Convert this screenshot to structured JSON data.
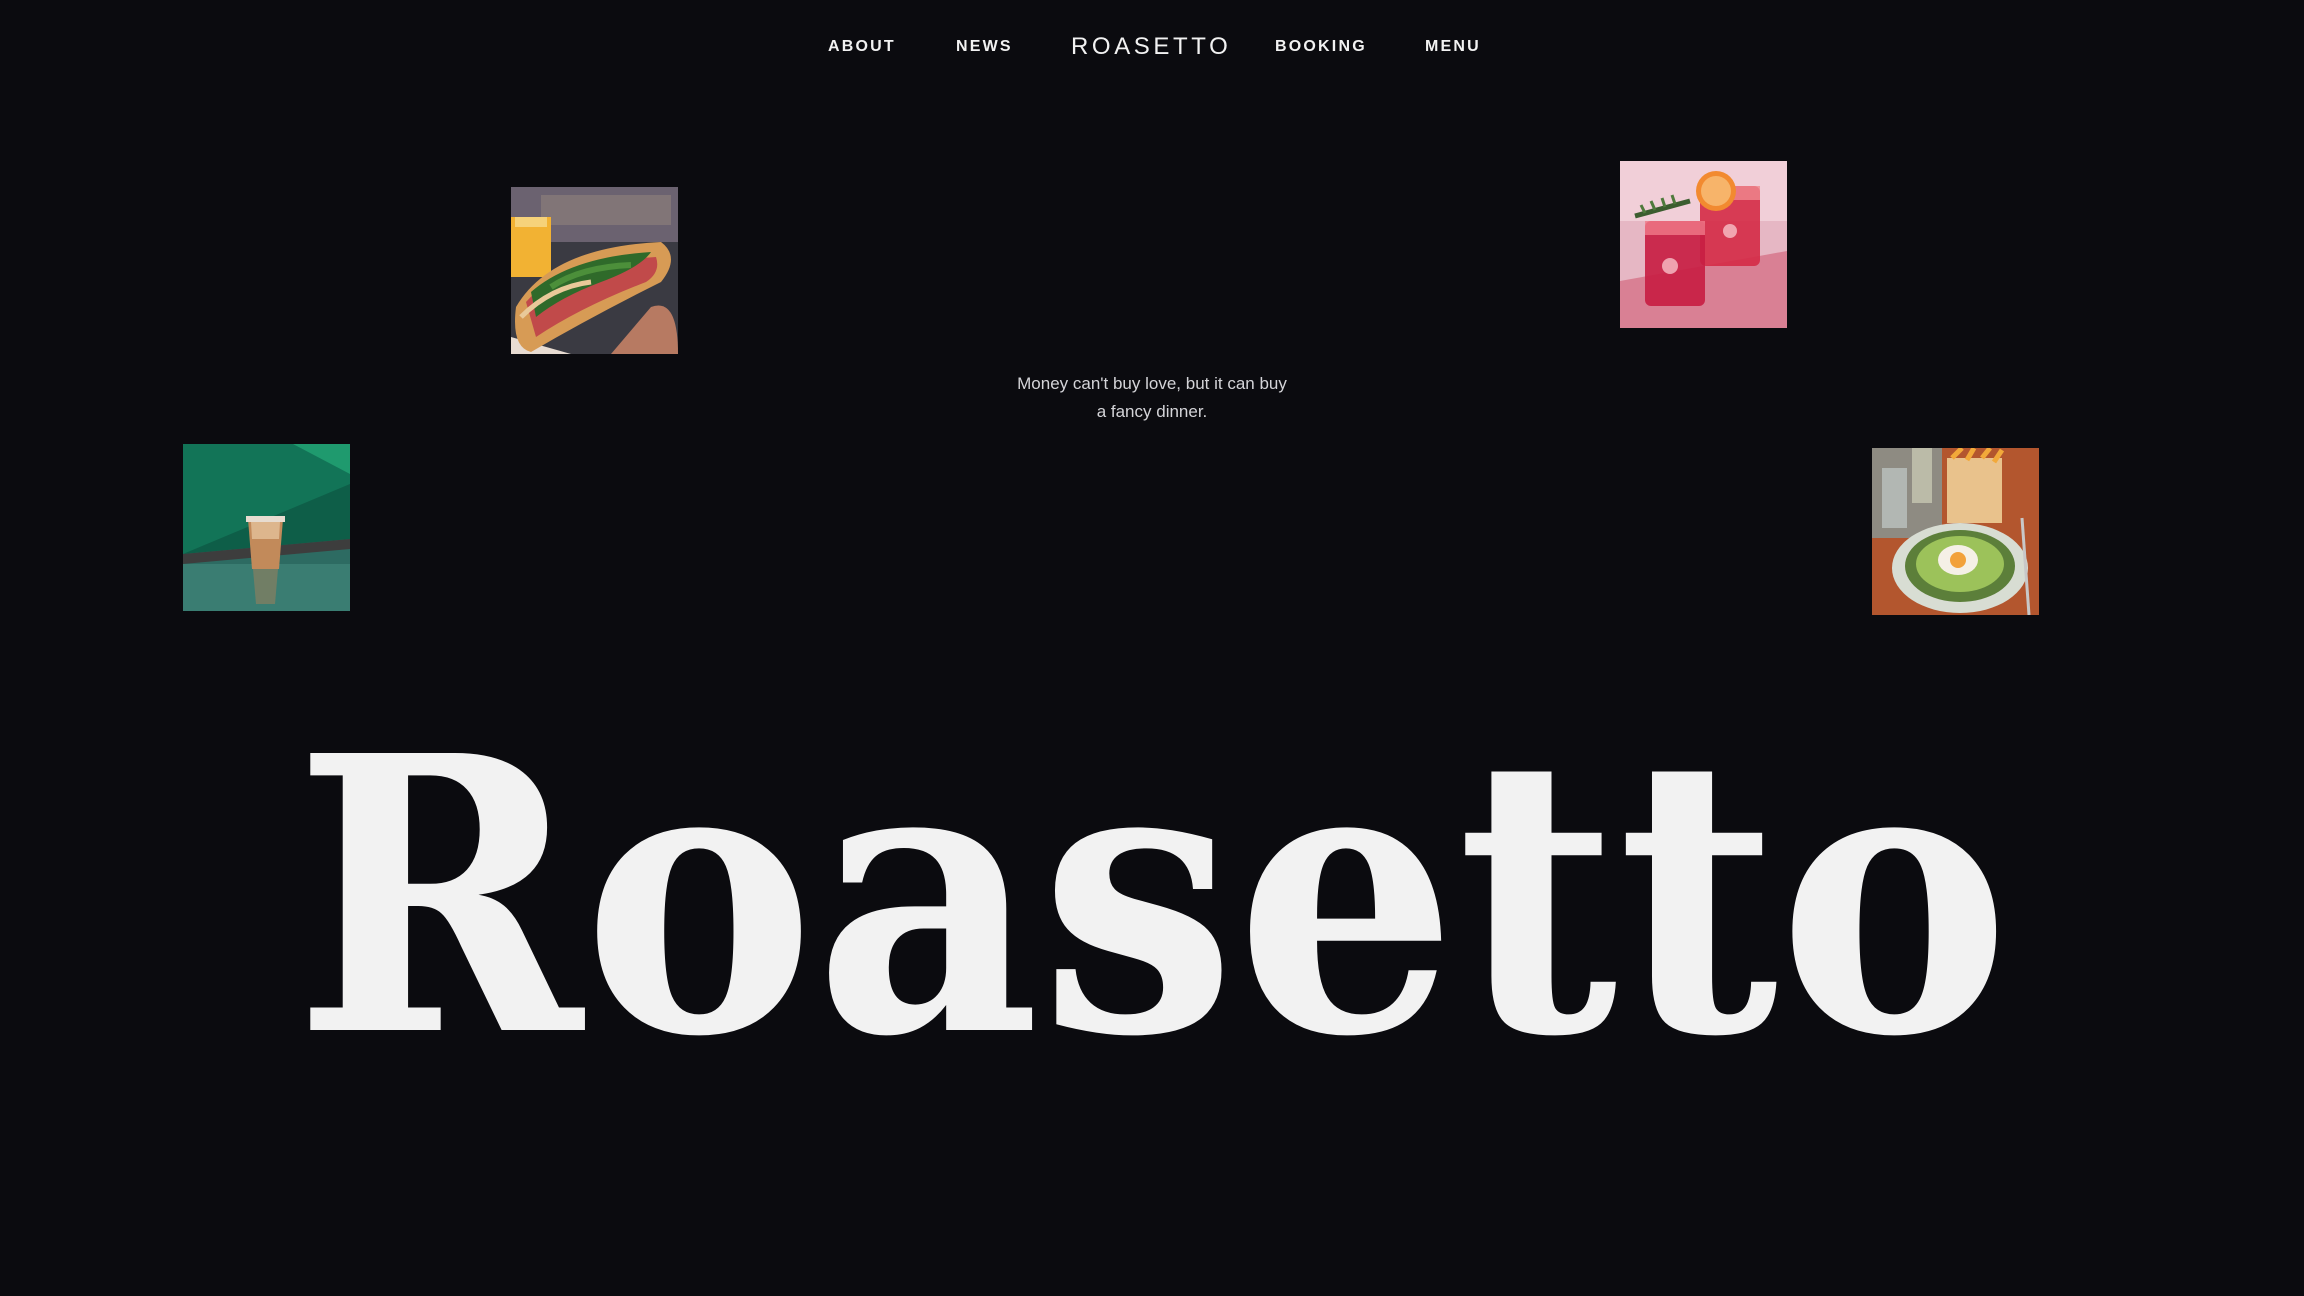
{
  "nav": {
    "about": "ABOUT",
    "news": "NEWS",
    "brand": "ROASETTO",
    "booking": "BOOKING",
    "menu": "MENU"
  },
  "tagline": {
    "line1": "Money can't buy love, but it can buy",
    "line2": "a fancy dinner."
  },
  "hero": {
    "wordmark": "Roasetto"
  },
  "photos": [
    {
      "name": "sandwich-photo"
    },
    {
      "name": "cocktails-photo"
    },
    {
      "name": "iced-coffee-photo"
    },
    {
      "name": "soup-bowl-photo"
    }
  ],
  "colors": {
    "background": "#0b0b0f",
    "text": "#f2f2f2",
    "muted": "#d4d4d8"
  }
}
